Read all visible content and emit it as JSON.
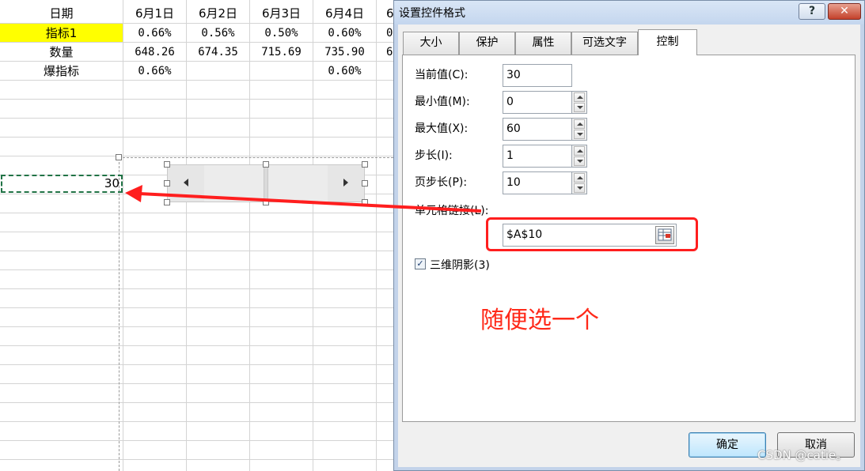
{
  "sheet": {
    "headers": [
      "日期",
      "6月1日",
      "6月2日",
      "6月3日",
      "6月4日",
      "6"
    ],
    "rows": [
      {
        "label": "指标1",
        "values": [
          "0.66%",
          "0.56%",
          "0.50%",
          "0.60%",
          "0"
        ]
      },
      {
        "label": "数量",
        "values": [
          "648.26",
          "674.35",
          "715.69",
          "735.90",
          "6"
        ]
      },
      {
        "label": "爆指标",
        "values": [
          "0.66%",
          "",
          "",
          "0.60%",
          ""
        ]
      }
    ],
    "selected_cell_value": "30",
    "highlight_color": "#ffff00"
  },
  "dialog": {
    "title": "设置控件格式",
    "help": "?",
    "close": "✕",
    "tabs": [
      "大小",
      "保护",
      "属性",
      "可选文字",
      "控制"
    ],
    "active_tab": "控制",
    "fields": [
      {
        "label": "当前值(C):",
        "value": "30",
        "spinner": false
      },
      {
        "label": "最小值(M):",
        "value": "0",
        "spinner": true
      },
      {
        "label": "最大值(X):",
        "value": "60",
        "spinner": true
      },
      {
        "label": "步长(I):",
        "value": "1",
        "spinner": true
      },
      {
        "label": "页步长(P):",
        "value": "10",
        "spinner": true
      }
    ],
    "cell_link_label": "单元格链接(L):",
    "cell_link_value": "$A$10",
    "checkbox_label": "三维阴影(3)",
    "checkbox_checked": true,
    "checkbox_mark": "✓",
    "ok_label": "确定",
    "cancel_label": "取消"
  },
  "annotation": {
    "text": "随便选一个",
    "color": "#ff1e1e"
  },
  "watermark": "CSDN @catie。"
}
